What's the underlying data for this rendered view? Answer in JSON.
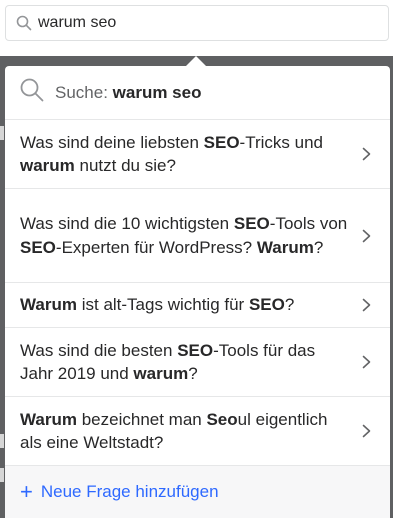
{
  "search": {
    "value": "warum seo"
  },
  "dropdown": {
    "search_prefix": "Suche: ",
    "search_query": "warum seo",
    "suggestions": [
      {
        "parts": [
          {
            "t": "Was sind deine liebsten ",
            "b": false
          },
          {
            "t": "SEO",
            "b": true
          },
          {
            "t": "-Tricks und ",
            "b": false
          },
          {
            "t": "warum",
            "b": true
          },
          {
            "t": " nutzt du sie?",
            "b": false
          }
        ]
      },
      {
        "parts": [
          {
            "t": "Was sind die 10 wichtigsten ",
            "b": false
          },
          {
            "t": "SEO",
            "b": true
          },
          {
            "t": "-Tools von ",
            "b": false
          },
          {
            "t": "SEO",
            "b": true
          },
          {
            "t": "-Experten für WordPress? ",
            "b": false
          },
          {
            "t": "Warum",
            "b": true
          },
          {
            "t": "?",
            "b": false
          }
        ]
      },
      {
        "parts": [
          {
            "t": "Warum",
            "b": true
          },
          {
            "t": " ist alt-Tags wichtig für ",
            "b": false
          },
          {
            "t": "SEO",
            "b": true
          },
          {
            "t": "?",
            "b": false
          }
        ]
      },
      {
        "parts": [
          {
            "t": "Was sind die besten ",
            "b": false
          },
          {
            "t": "SEO",
            "b": true
          },
          {
            "t": "-Tools für das Jahr 2019 und ",
            "b": false
          },
          {
            "t": "warum",
            "b": true
          },
          {
            "t": "?",
            "b": false
          }
        ]
      },
      {
        "parts": [
          {
            "t": "Warum",
            "b": true
          },
          {
            "t": " bezeichnet man ",
            "b": false
          },
          {
            "t": "Seo",
            "b": true
          },
          {
            "t": "ul eigentlich als eine Weltstadt?",
            "b": false
          }
        ]
      }
    ],
    "add_question_label": "Neue Frage hinzufügen"
  },
  "icons": {
    "search": "search-icon",
    "chevron": "chevron-right-icon",
    "add": "plus-icon"
  },
  "colors": {
    "accent": "#2e69ff",
    "text": "#282829",
    "muted": "#636466",
    "backdrop": "#5f6062"
  }
}
